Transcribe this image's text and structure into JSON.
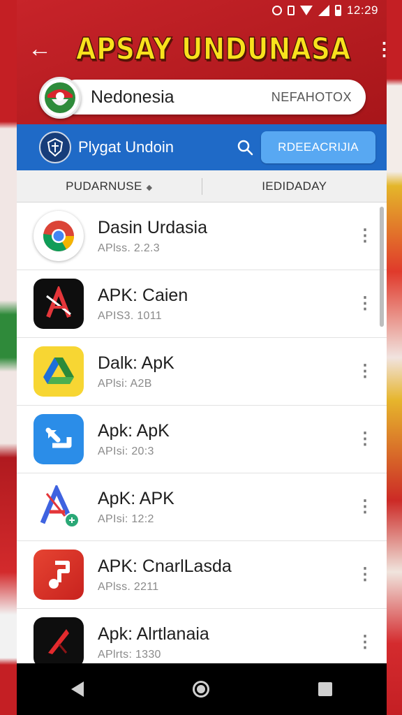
{
  "status_bar": {
    "time": "12:29"
  },
  "header": {
    "title": "APSAY UNDUNASA"
  },
  "region": {
    "name": "Nedonesia",
    "code": "NEFAHOTOX"
  },
  "blue_bar": {
    "label": "Plygat Undoin",
    "button_label": "RDEEACRIJIA"
  },
  "filters": {
    "left": "PUDARNUSE",
    "right": "IEDIDADAY"
  },
  "apps": [
    {
      "name": "Dasin Urdasia",
      "version": "APlss. 2.2.3",
      "icon": "chrome-icon"
    },
    {
      "name": "APK: Caien",
      "version": "APIS3. 1011",
      "icon": "red-a-icon"
    },
    {
      "name": "Dalk: ApK",
      "version": "APlsi: A2B",
      "icon": "drive-icon"
    },
    {
      "name": "Apk: ApK",
      "version": "APIsi: 20:3",
      "icon": "arrow-icon"
    },
    {
      "name": "ApK: APK",
      "version": "APIsi: 12:2",
      "icon": "blue-a-icon"
    },
    {
      "name": "APK: CnarlLasda",
      "version": "APlss. 2211",
      "icon": "music-note-icon"
    },
    {
      "name": "Apk: Alrtlanaia",
      "version": "APlrts: 1330",
      "icon": "red-arrow-icon"
    }
  ],
  "colors": {
    "brand_red": "#b51a1e",
    "title_yellow": "#f8e21d",
    "blue_bar": "#1f6ac7",
    "button_blue": "#58a8f2"
  }
}
